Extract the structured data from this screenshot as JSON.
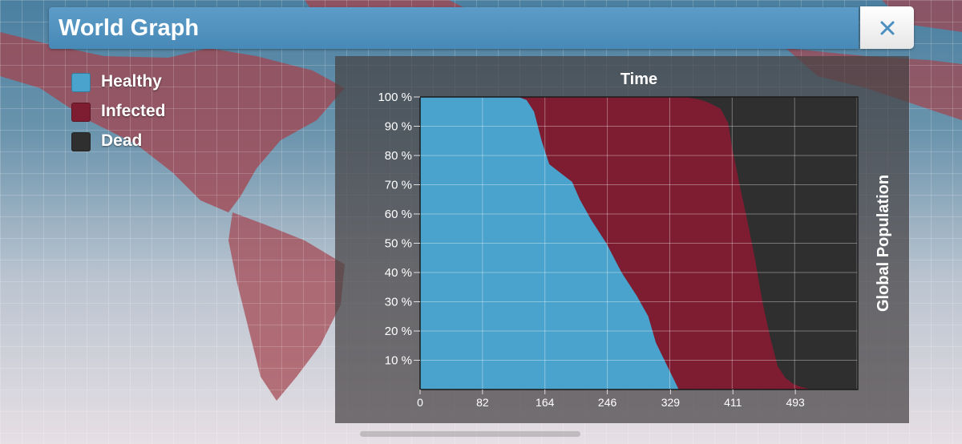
{
  "window": {
    "title": "World Graph",
    "close_label": "×"
  },
  "legend": [
    {
      "label": "Healthy",
      "color": "#4aa3cc"
    },
    {
      "label": "Infected",
      "color": "#7e1d31"
    },
    {
      "label": "Dead",
      "color": "#2f2f2f"
    }
  ],
  "chart_data": {
    "type": "area",
    "stacked": true,
    "top_label": "Time",
    "ylabel": "Global Population",
    "x_ticks": [
      "0",
      "82",
      "164",
      "246",
      "329",
      "411",
      "493"
    ],
    "y_ticks": [
      "10 %",
      "20 %",
      "30 %",
      "40 %",
      "50 %",
      "60 %",
      "70 %",
      "80 %",
      "90 %",
      "100 %"
    ],
    "xlim": [
      0,
      575
    ],
    "ylim": [
      0,
      100
    ],
    "grid": true,
    "x": [
      0,
      130,
      140,
      150,
      160,
      170,
      180,
      200,
      210,
      225,
      245,
      265,
      285,
      300,
      310,
      340,
      350,
      370,
      380,
      395,
      405,
      410,
      420,
      430,
      440,
      450,
      460,
      470,
      480,
      490,
      500,
      515,
      530,
      575
    ],
    "series": [
      {
        "name": "Healthy",
        "color": "#4aa3cc",
        "values": [
          100,
          100,
          99,
          95,
          85,
          77,
          75,
          71,
          65,
          58,
          50,
          40,
          32,
          25,
          16,
          0,
          0,
          0,
          0,
          0,
          0,
          0,
          0,
          0,
          0,
          0,
          0,
          0,
          0,
          0,
          0,
          0,
          0,
          0
        ]
      },
      {
        "name": "Infected",
        "color": "#7e1d31",
        "values": [
          0,
          0,
          1,
          5,
          15,
          23,
          25,
          29,
          35,
          42,
          50,
          60,
          68,
          75,
          84,
          100,
          100,
          99,
          98,
          96,
          91,
          83,
          70,
          58,
          45,
          30,
          18,
          8,
          4,
          2,
          1,
          0,
          0,
          0
        ]
      },
      {
        "name": "Dead",
        "color": "#2f2f2f",
        "values": [
          0,
          0,
          0,
          0,
          0,
          0,
          0,
          0,
          0,
          0,
          0,
          0,
          0,
          0,
          0,
          0,
          0,
          1,
          2,
          4,
          9,
          17,
          30,
          42,
          55,
          70,
          82,
          92,
          96,
          98,
          99,
          100,
          100,
          100
        ]
      }
    ]
  }
}
